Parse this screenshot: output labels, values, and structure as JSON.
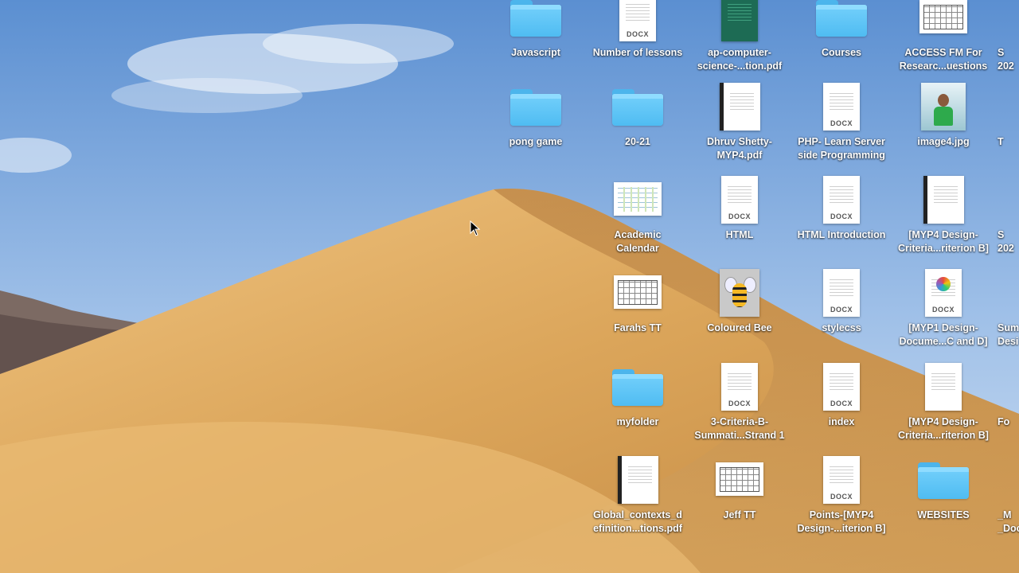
{
  "desktop": {
    "icons": [
      {
        "label": "Javascript",
        "kind": "folder",
        "icon": "folder-icon"
      },
      {
        "label": "Number of lessons",
        "kind": "doc",
        "tag": "DOCX",
        "icon": "docx-file-icon"
      },
      {
        "label": "ap-computer-\nscience-...tion.pdf",
        "kind": "doc-dark",
        "icon": "pdf-file-icon"
      },
      {
        "label": "Courses",
        "kind": "folder",
        "icon": "folder-icon"
      },
      {
        "label": "ACCESS FM For\nResearc...uestions",
        "kind": "landscape",
        "icon": "document-thumbnail-icon"
      },
      {
        "label": "pong game",
        "kind": "folder",
        "icon": "folder-icon"
      },
      {
        "label": "20-21",
        "kind": "folder",
        "icon": "folder-icon"
      },
      {
        "label": "Dhruv Shetty-\nMYP4.pdf",
        "kind": "doc-spiral",
        "icon": "pdf-file-icon"
      },
      {
        "label": "PHP- Learn Server\nside Programming",
        "kind": "doc",
        "tag": "DOCX",
        "icon": "docx-file-icon"
      },
      {
        "label": "image4.jpg",
        "kind": "photo",
        "icon": "image-file-icon"
      },
      {
        "label": "Academic\nCalendar",
        "kind": "landscape-cal",
        "icon": "calendar-thumbnail-icon"
      },
      {
        "label": "HTML",
        "kind": "doc",
        "tag": "DOCX",
        "icon": "docx-file-icon"
      },
      {
        "label": "HTML Introduction",
        "kind": "doc",
        "tag": "DOCX",
        "icon": "docx-file-icon"
      },
      {
        "label": "[MYP4 Design-\nCriteria...riterion B]",
        "kind": "doc-spiral",
        "icon": "pdf-file-icon"
      },
      {
        "label": "Farahs TT",
        "kind": "landscape",
        "icon": "timetable-thumbnail-icon"
      },
      {
        "label": "Coloured Bee",
        "kind": "bee",
        "icon": "bee-image-icon"
      },
      {
        "label": "stylecss",
        "kind": "doc",
        "tag": "DOCX",
        "icon": "docx-file-icon"
      },
      {
        "label": "[MYP1 Design-\nDocume...C and D]",
        "kind": "doc-ring",
        "tag": "DOCX",
        "icon": "docx-file-icon"
      },
      {
        "label": "myfolder",
        "kind": "folder",
        "icon": "folder-icon"
      },
      {
        "label": "3-Criteria-B-\nSummati...Strand 1",
        "kind": "doc",
        "tag": "DOCX",
        "icon": "docx-file-icon"
      },
      {
        "label": "index",
        "kind": "doc",
        "tag": "DOCX",
        "icon": "docx-file-icon"
      },
      {
        "label": "[MYP4 Design-\nCriteria...riterion B]",
        "kind": "doc",
        "icon": "document-file-icon"
      },
      {
        "label": "Global_contexts_d\nefinition...tions.pdf",
        "kind": "doc-spiral",
        "icon": "pdf-file-icon"
      },
      {
        "label": "Jeff TT",
        "kind": "landscape",
        "icon": "timetable-thumbnail-icon"
      },
      {
        "label": "Points-[MYP4\nDesign-...iterion B]",
        "kind": "doc",
        "tag": "DOCX",
        "icon": "docx-file-icon"
      },
      {
        "label": "WEBSITES",
        "kind": "folder",
        "icon": "folder-icon"
      },
      {
        "label": "S\n202",
        "kind": "text-only",
        "icon": "partial-file-icon"
      },
      {
        "label": "T",
        "kind": "text-only",
        "icon": "partial-file-icon"
      },
      {
        "label": "S\n202",
        "kind": "text-only",
        "icon": "partial-file-icon"
      },
      {
        "label": "Sum\nDesi",
        "kind": "text-only",
        "icon": "partial-file-icon"
      },
      {
        "label": "Fo",
        "kind": "text-only",
        "icon": "partial-file-icon"
      },
      {
        "label": "_M\n_Doc",
        "kind": "text-only",
        "icon": "partial-file-icon"
      }
    ]
  },
  "colors": {
    "sky_top": "#5e93d3",
    "sky_bottom": "#b9d3ee",
    "dune_light": "#e6b56d",
    "dune_dark": "#b7813e",
    "folder_blue": "#5cc6f6"
  }
}
